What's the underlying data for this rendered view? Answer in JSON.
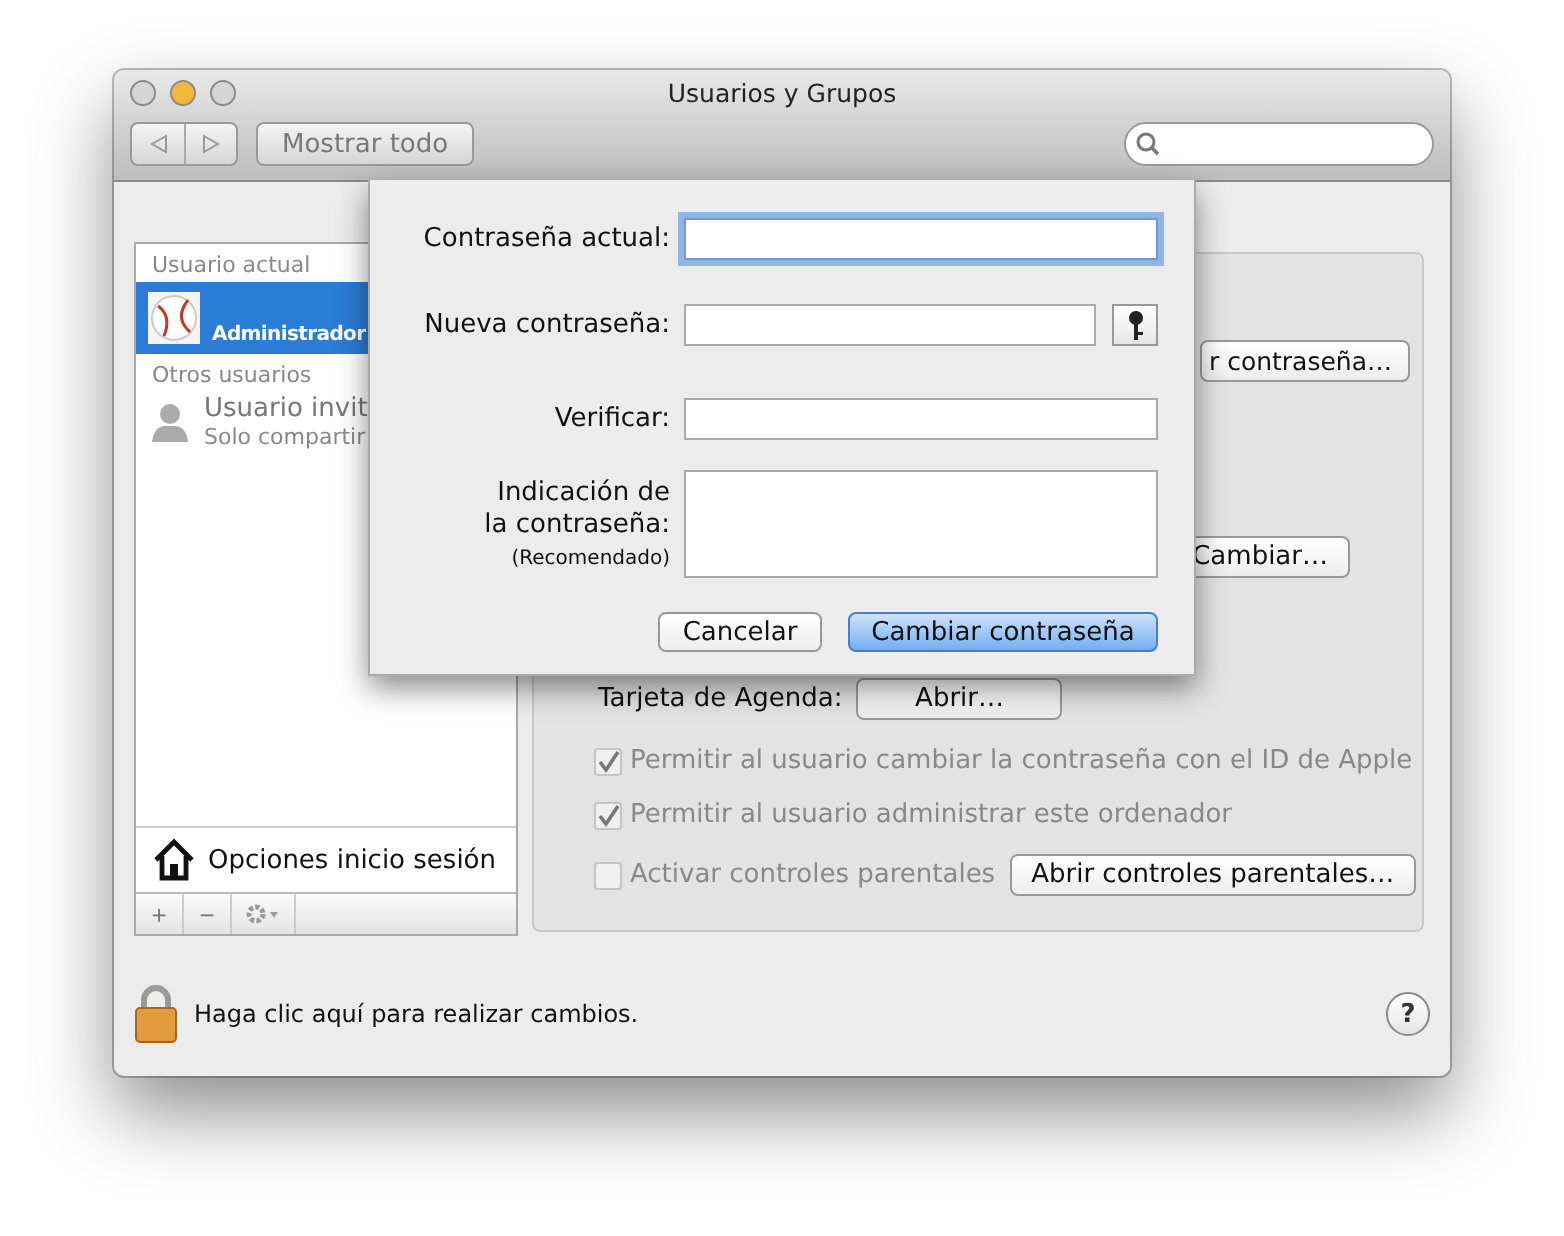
{
  "window": {
    "title": "Usuarios y Grupos"
  },
  "toolbar": {
    "show_all": "Mostrar todo"
  },
  "sidebar": {
    "sections": [
      {
        "header": "Usuario actual",
        "users": [
          {
            "name": "Administrador",
            "selected": true,
            "kind": "baseball"
          }
        ]
      },
      {
        "header": "Otros usuarios",
        "users": [
          {
            "name": "Usuario invit",
            "subtitle": "Solo compartir",
            "selected": false,
            "kind": "guest"
          }
        ]
      }
    ],
    "login_options": "Opciones inicio sesión",
    "buttons": [
      "+",
      "−"
    ]
  },
  "detail": {
    "change_password_button": "r contraseña…",
    "change_button": "Cambiar…",
    "contact_card": {
      "label": "Tarjeta de Agenda:",
      "button": "Abrir…"
    },
    "options": [
      {
        "label": "Permitir al usuario cambiar la contraseña con el ID de Apple",
        "checked": true,
        "disabled": true
      },
      {
        "label": "Permitir al usuario administrar este ordenador",
        "checked": true,
        "disabled": true
      },
      {
        "label": "Activar controles parentales",
        "checked": false,
        "disabled": true,
        "button": "Abrir controles parentales…"
      }
    ]
  },
  "sheet": {
    "fields": [
      {
        "kind": "field",
        "label_lines": [
          "Contraseña actual:"
        ],
        "focused": true
      },
      {
        "kind": "field_key",
        "label_lines": [
          "Nueva contraseña:"
        ],
        "focused": false
      },
      {
        "kind": "field",
        "label_lines": [
          "Verificar:"
        ],
        "focused": false
      },
      {
        "kind": "hint",
        "label_lines": [
          "Indicación de",
          "la contraseña:"
        ],
        "note": "(Recomendado)",
        "focused": false
      }
    ],
    "buttons": [
      {
        "label": "Cancelar",
        "default": false
      },
      {
        "label": "Cambiar contraseña",
        "default": true
      }
    ]
  },
  "footer": {
    "lock_text": "Haga clic aquí para realizar cambios.",
    "locked": true,
    "help": "?"
  }
}
